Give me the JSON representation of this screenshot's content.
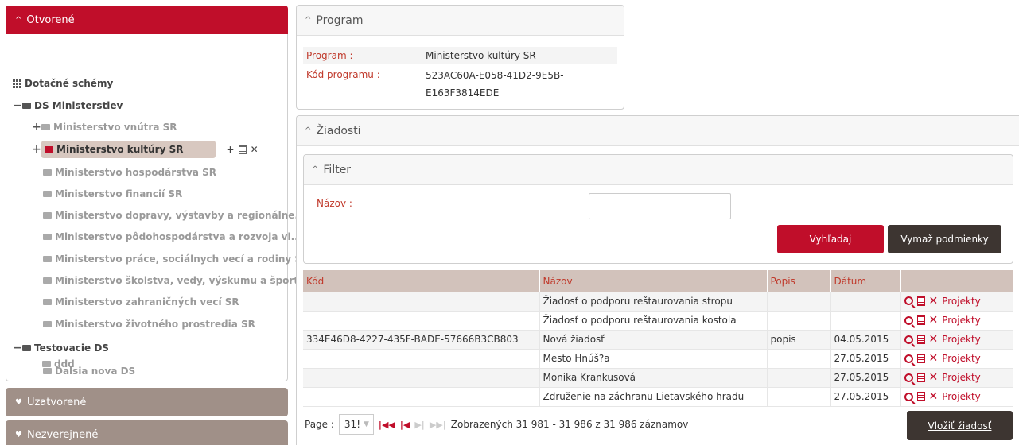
{
  "left": {
    "open_section": "Otvorené",
    "closed_sections": [
      "Uzatvorené",
      "Nezverejnené"
    ],
    "tree": {
      "root": "Dotačné schémy",
      "groups": [
        {
          "label": "DS Ministerstiev",
          "items": [
            "Ministerstvo vnútra SR",
            "Ministerstvo kultúry SR",
            "Ministerstvo hospodárstva SR",
            "Ministerstvo financií SR",
            "Ministerstvo dopravy, výstavby a regionálne...",
            "Ministerstvo pôdohospodárstva a rozvoja vi...",
            "Ministerstvo práce, sociálnych vecí a rodiny SR",
            "Ministerstvo školstva, vedy, výskumu a šport...",
            "Ministerstvo zahraničných vecí SR",
            "Ministerstvo životného prostredia SR"
          ]
        },
        {
          "label": "Testovacie DS",
          "items": [
            "Dalsia nova DS",
            "ddd"
          ]
        }
      ]
    }
  },
  "program": {
    "title": "Program",
    "program_label": "Program :",
    "program_value": "Ministerstvo kultúry SR",
    "code_label": "Kód programu :",
    "code_value_line1": "523AC60A-E058-41D2-9E5B-",
    "code_value_line2": "E163F3814EDE"
  },
  "ziadosti": {
    "title": "Žiadosti",
    "filter": {
      "title": "Filter",
      "name_label": "Názov :",
      "name_value": "",
      "search_button": "Vyhľadaj",
      "clear_button": "Vymaž podmienky"
    },
    "table": {
      "headers": [
        "Kód",
        "Názov",
        "Popis",
        "Dátum",
        ""
      ],
      "rows": [
        [
          "",
          "Žiadosť o podporu reštaurovania stropu",
          "",
          ""
        ],
        [
          "",
          "Žiadosť o podporu reštaurovania kostola",
          "",
          ""
        ],
        [
          "334E46D8-4227-435F-BADE-57666B3CB803",
          "Nová žiadosť",
          "popis",
          "04.05.2015"
        ],
        [
          "",
          "Mesto Hnúš?a",
          "",
          "27.05.2015"
        ],
        [
          "",
          "Monika Krankusová",
          "",
          "27.05.2015"
        ],
        [
          "",
          "Združenie na záchranu Lietavského hradu",
          "",
          "27.05.2015"
        ]
      ],
      "row_action_label": "Projekty"
    },
    "pager": {
      "page_label": "Page :",
      "page_value": "31!",
      "summary": "Zobrazených 31 981 - 31 986 z 31 986 záznamov"
    },
    "insert_button": "Vložiť žiadosť"
  }
}
